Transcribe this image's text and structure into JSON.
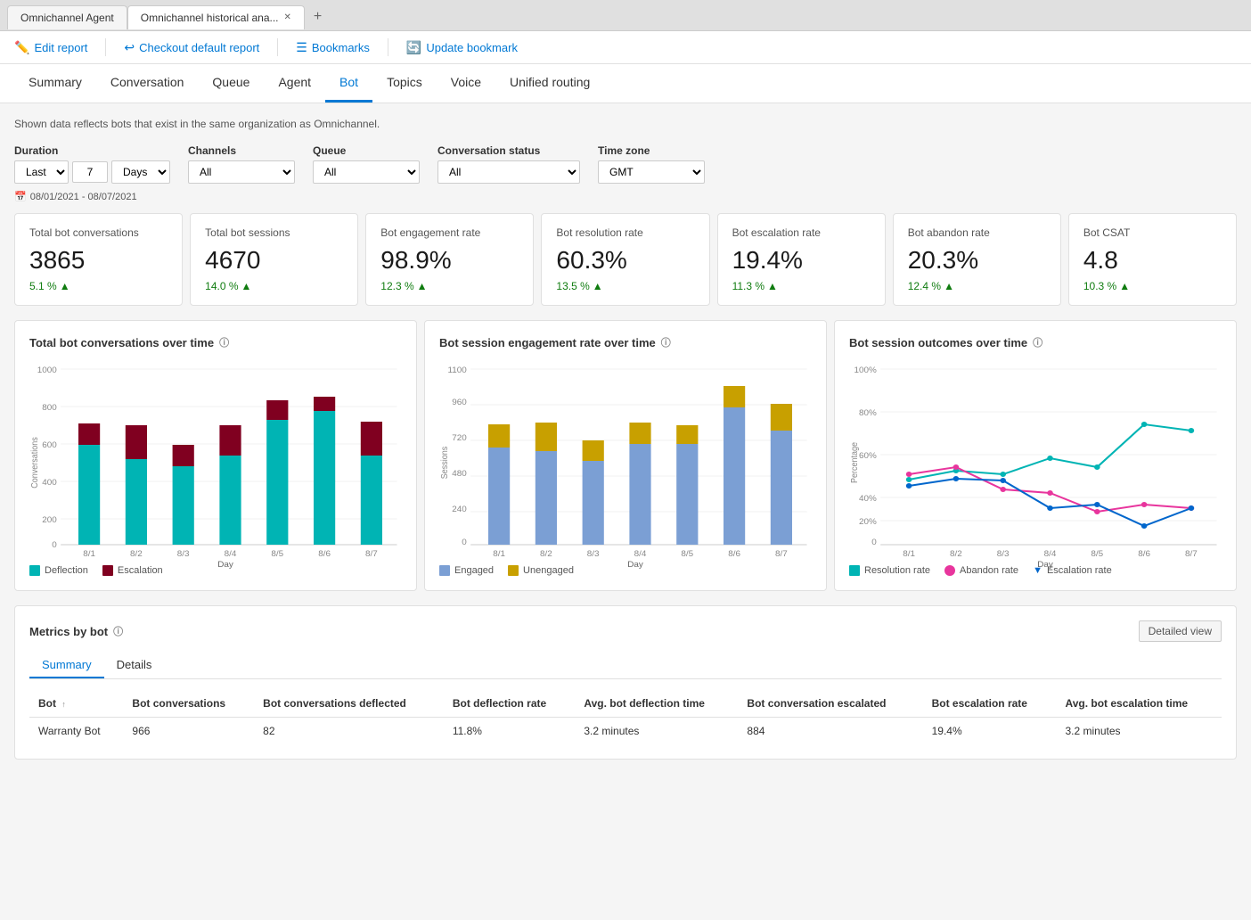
{
  "browser": {
    "tabs": [
      {
        "id": "tab1",
        "label": "Omnichannel Agent",
        "active": false,
        "closeable": false
      },
      {
        "id": "tab2",
        "label": "Omnichannel historical ana...",
        "active": true,
        "closeable": true
      }
    ]
  },
  "toolbar": {
    "edit_report": "Edit report",
    "checkout_report": "Checkout default report",
    "bookmarks": "Bookmarks",
    "update_bookmark": "Update bookmark"
  },
  "nav": {
    "tabs": [
      "Summary",
      "Conversation",
      "Queue",
      "Agent",
      "Bot",
      "Topics",
      "Voice",
      "Unified routing"
    ],
    "active": "Bot"
  },
  "info_text": "Shown data reflects bots that exist in the same organization as Omnichannel.",
  "filters": {
    "duration_label": "Duration",
    "duration_type": "Last",
    "duration_value": "7",
    "duration_unit": "Days",
    "channels_label": "Channels",
    "channels_value": "All",
    "queue_label": "Queue",
    "queue_value": "All",
    "conversation_status_label": "Conversation status",
    "conversation_status_value": "All",
    "timezone_label": "Time zone",
    "timezone_value": "GMT",
    "date_range": "08/01/2021 - 08/07/2021"
  },
  "kpi_cards": [
    {
      "title": "Total bot conversations",
      "value": "3865",
      "change": "5.1 %",
      "trend": "up"
    },
    {
      "title": "Total bot sessions",
      "value": "4670",
      "change": "14.0 %",
      "trend": "up"
    },
    {
      "title": "Bot engagement rate",
      "value": "98.9%",
      "change": "12.3 %",
      "trend": "up"
    },
    {
      "title": "Bot resolution rate",
      "value": "60.3%",
      "change": "13.5 %",
      "trend": "up"
    },
    {
      "title": "Bot escalation rate",
      "value": "19.4%",
      "change": "11.3 %",
      "trend": "up"
    },
    {
      "title": "Bot abandon rate",
      "value": "20.3%",
      "change": "12.4 %",
      "trend": "up"
    },
    {
      "title": "Bot CSAT",
      "value": "4.8",
      "change": "10.3 %",
      "trend": "up"
    }
  ],
  "charts": {
    "conversations_over_time": {
      "title": "Total bot conversations over time",
      "y_label": "Conversations",
      "x_label": "Day",
      "y_max": 1000,
      "y_ticks": [
        0,
        200,
        400,
        600,
        800,
        1000
      ],
      "days": [
        "8/1",
        "8/2",
        "8/3",
        "8/4",
        "8/5",
        "8/6",
        "8/7"
      ],
      "deflection": [
        560,
        480,
        440,
        500,
        700,
        750,
        500
      ],
      "escalation": [
        120,
        190,
        120,
        170,
        110,
        80,
        190
      ],
      "legend": [
        {
          "label": "Deflection",
          "color": "#00b4b4"
        },
        {
          "label": "Escalation",
          "color": "#800020"
        }
      ]
    },
    "engagement_rate": {
      "title": "Bot session engagement rate over time",
      "y_label": "Sessions",
      "x_label": "Day",
      "y_max": 1100,
      "y_ticks": [
        0,
        240,
        480,
        720,
        960,
        1100
      ],
      "days": [
        "8/1",
        "8/2",
        "8/3",
        "8/4",
        "8/5",
        "8/6",
        "8/7"
      ],
      "engaged": [
        580,
        560,
        500,
        600,
        600,
        820,
        680
      ],
      "unengaged": [
        140,
        170,
        120,
        130,
        110,
        130,
        160
      ],
      "legend": [
        {
          "label": "Engaged",
          "color": "#7b9fd4"
        },
        {
          "label": "Unengaged",
          "color": "#c8a000"
        }
      ]
    },
    "outcomes_over_time": {
      "title": "Bot session outcomes over time",
      "y_label": "Percentage",
      "x_label": "Day",
      "days": [
        "8/1",
        "8/2",
        "8/3",
        "8/4",
        "8/5",
        "8/6",
        "8/7"
      ],
      "resolution_rate": [
        35,
        40,
        38,
        47,
        42,
        65,
        62
      ],
      "abandon_rate": [
        38,
        42,
        30,
        28,
        18,
        22,
        20
      ],
      "escalation_rate": [
        32,
        36,
        35,
        20,
        22,
        10,
        20
      ],
      "legend": [
        {
          "label": "Resolution rate",
          "color": "#00b4b4"
        },
        {
          "label": "Abandon rate",
          "color": "#e8359d"
        },
        {
          "label": "Escalation rate",
          "color": "#0066cc"
        }
      ]
    }
  },
  "metrics_by_bot": {
    "title": "Metrics by bot",
    "detailed_view_label": "Detailed view",
    "sub_tabs": [
      "Summary",
      "Details"
    ],
    "active_sub_tab": "Summary",
    "columns": [
      "Bot",
      "Bot conversations",
      "Bot conversations deflected",
      "Bot deflection rate",
      "Avg. bot deflection time",
      "Bot conversation escalated",
      "Bot escalation rate",
      "Avg. bot escalation time"
    ],
    "rows": [
      {
        "bot": "Warranty Bot",
        "bot_conversations": "966",
        "deflected": "82",
        "deflection_rate": "11.8%",
        "avg_deflection_time": "3.2 minutes",
        "escalated": "884",
        "escalation_rate": "19.4%",
        "avg_escalation_time": "3.2 minutes"
      }
    ]
  }
}
